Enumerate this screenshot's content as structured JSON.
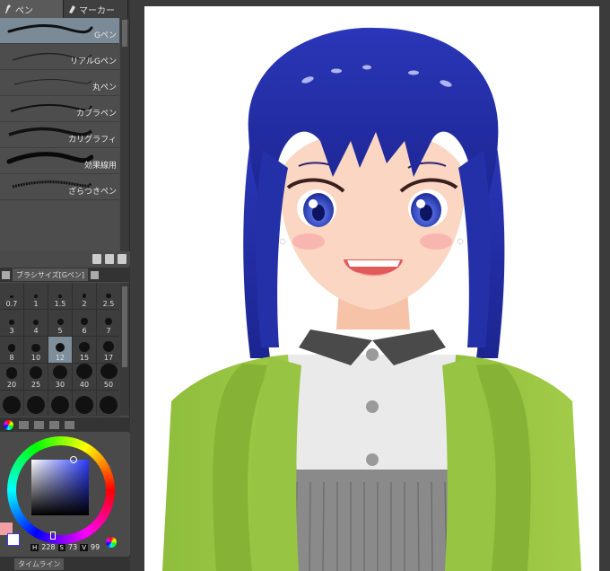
{
  "tool_tabs": [
    {
      "label": "ペン",
      "icon": "pen-icon"
    },
    {
      "label": "マーカー",
      "icon": "marker-icon"
    }
  ],
  "brushes": [
    {
      "label": "Gペン",
      "selected": true
    },
    {
      "label": "リアルGペン",
      "selected": false
    },
    {
      "label": "丸ペン",
      "selected": false
    },
    {
      "label": "カブラペン",
      "selected": false
    },
    {
      "label": "カリグラフィ",
      "selected": false
    },
    {
      "label": "効果線用",
      "selected": false
    },
    {
      "label": "ざらつきペン",
      "selected": false
    }
  ],
  "brush_size_panel": {
    "tab_label": "ブラシサイズ[Gペン]",
    "sizes": [
      "0.7",
      "1",
      "1.5",
      "2",
      "2.5",
      "3",
      "4",
      "5",
      "6",
      "7",
      "8",
      "10",
      "12",
      "15",
      "17",
      "20",
      "25",
      "30",
      "40",
      "50"
    ],
    "selected": "12"
  },
  "color": {
    "main_color": "#f3a0a5",
    "sub_color": "#ffffff",
    "h_label": "H",
    "h_value": "228",
    "s_label": "S",
    "s_value": "73",
    "v_label": "V",
    "v_value": "99"
  },
  "timeline": {
    "label": "タイムライン"
  }
}
